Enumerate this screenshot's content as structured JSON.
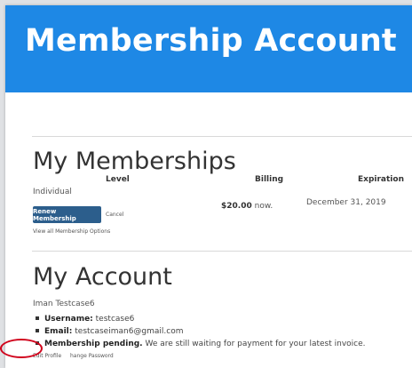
{
  "banner": {
    "title": "Membership Account"
  },
  "memberships": {
    "title": "My Memberships",
    "columns": {
      "level": "Level",
      "billing": "Billing",
      "expiration": "Expiration"
    },
    "level_name": "Individual",
    "renew_label": "Renew Membership",
    "cancel_label": "Cancel",
    "billing_amount": "$20.00",
    "billing_suffix": "now.",
    "expiration_date": "December 31, 2019",
    "view_all_label": "View all Membership Options"
  },
  "account": {
    "title": "My Account",
    "display_name": "Iman Testcase6",
    "username_label": "Username:",
    "username": "testcase6",
    "email_label": "Email:",
    "email": "testcaseiman6@gmail.com",
    "pending_label": "Membership pending.",
    "pending_text": "We are still waiting for payment for your latest invoice.",
    "edit_profile_label": "Edit Profile",
    "change_password_label": "hange Password"
  },
  "colors": {
    "banner": "#1e88e5",
    "button": "#2c5e8c",
    "annotation_circle": "#d0021b"
  }
}
